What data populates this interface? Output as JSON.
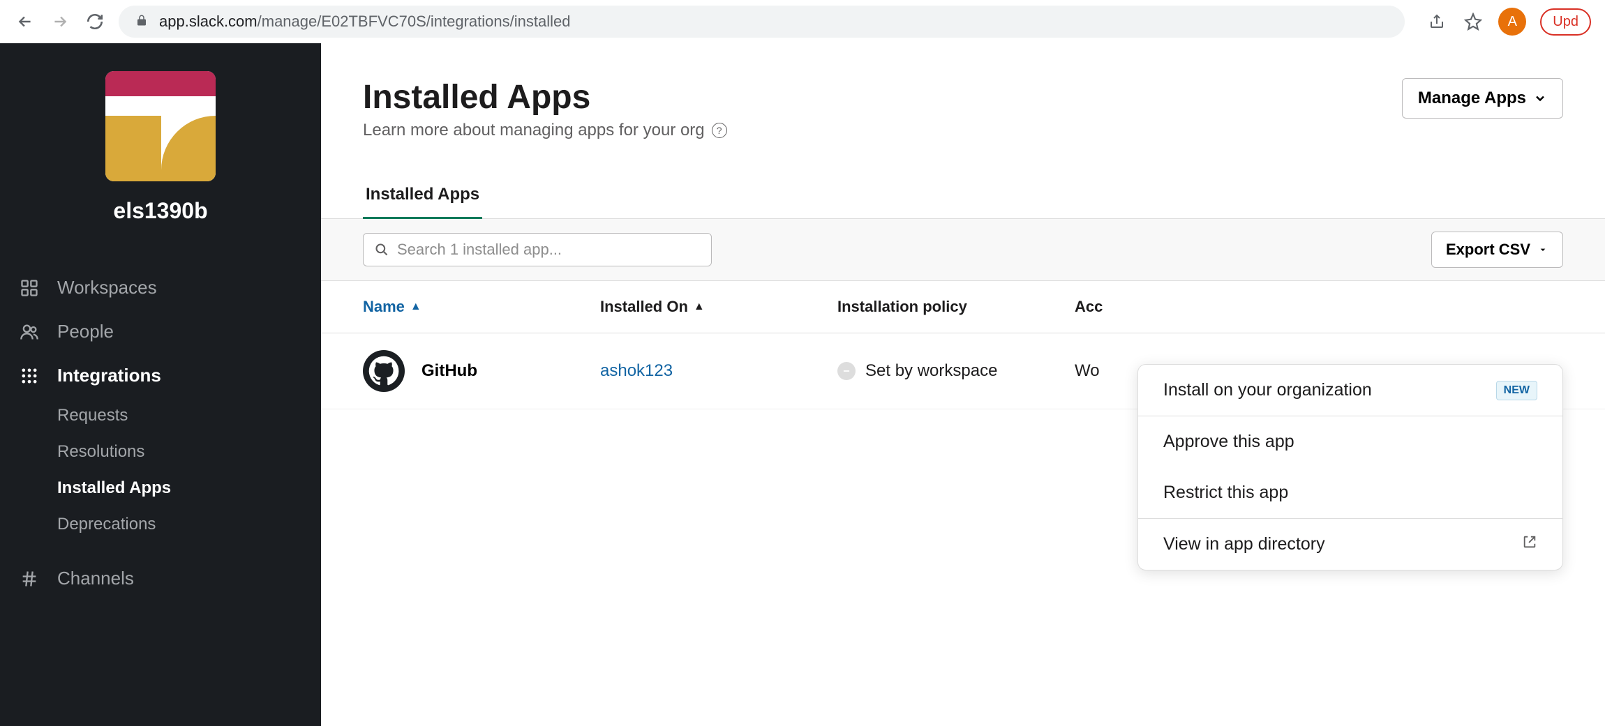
{
  "browser": {
    "url_host": "app.slack.com",
    "url_path": "/manage/E02TBFVC70S/integrations/installed",
    "avatar_letter": "A",
    "update_label": "Upd"
  },
  "sidebar": {
    "org_name": "els1390b",
    "items": [
      {
        "icon": "grid",
        "label": "Workspaces",
        "active": false
      },
      {
        "icon": "people",
        "label": "People",
        "active": false
      },
      {
        "icon": "integrations",
        "label": "Integrations",
        "active": true,
        "sub": [
          {
            "label": "Requests",
            "active": false
          },
          {
            "label": "Resolutions",
            "active": false
          },
          {
            "label": "Installed Apps",
            "active": true
          },
          {
            "label": "Deprecations",
            "active": false
          }
        ]
      },
      {
        "icon": "hash",
        "label": "Channels",
        "active": false
      }
    ]
  },
  "page": {
    "title": "Installed Apps",
    "subtitle": "Learn more about managing apps for your org",
    "manage_apps_label": "Manage Apps"
  },
  "tabs": [
    {
      "label": "Installed Apps",
      "active": true
    }
  ],
  "toolbar": {
    "search_placeholder": "Search 1 installed app...",
    "export_label": "Export CSV"
  },
  "table": {
    "columns": {
      "name": "Name",
      "installed_on": "Installed On",
      "policy": "Installation policy",
      "access": "Acc"
    },
    "rows": [
      {
        "app_name": "GitHub",
        "installed_on": "ashok123",
        "policy": "Set by workspace",
        "access": "Wo"
      }
    ]
  },
  "dropdown": {
    "install_org": "Install on your organization",
    "new_badge": "NEW",
    "approve": "Approve this app",
    "restrict": "Restrict this app",
    "view_directory": "View in app directory"
  }
}
